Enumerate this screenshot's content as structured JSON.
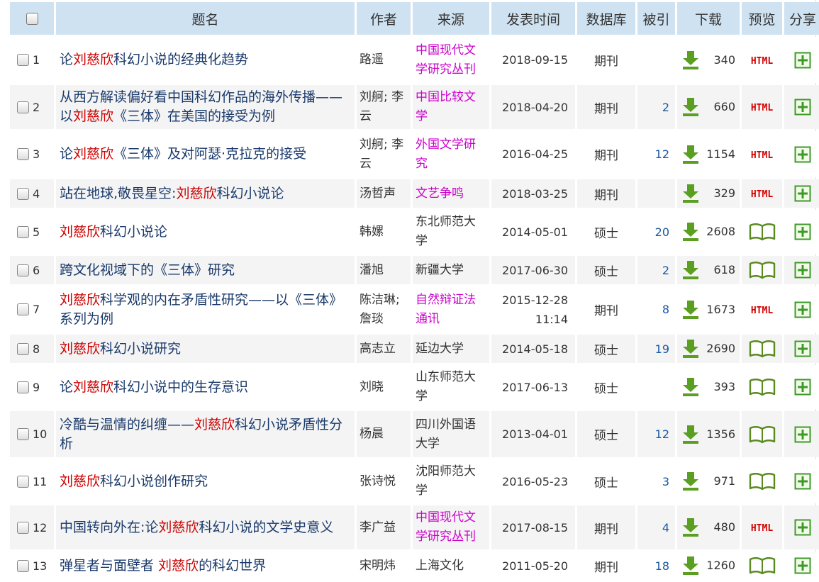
{
  "header": {
    "title": "题名",
    "author": "作者",
    "source": "来源",
    "date": "发表时间",
    "database": "数据库",
    "cited": "被引",
    "download": "下载",
    "preview": "预览",
    "share": "分享"
  },
  "rows": [
    {
      "num": "1",
      "title": [
        {
          "t": "论"
        },
        {
          "t": "刘慈欣",
          "kw": true
        },
        {
          "t": "科幻小说的经典化趋势"
        }
      ],
      "author": "路遥",
      "source": "中国现代文学研究丛刊",
      "source_color": "pink",
      "date": "2018-09-15",
      "db": "期刊",
      "cited": "",
      "downloads": "340",
      "preview": "html"
    },
    {
      "num": "2",
      "title": [
        {
          "t": "从西方解读偏好看中国科幻作品的海外传播——以"
        },
        {
          "t": "刘慈欣",
          "kw": true
        },
        {
          "t": "《三体》在美国的接受为例"
        }
      ],
      "author": "刘舸; 李云",
      "source": "中国比较文学",
      "source_color": "pink",
      "date": "2018-04-20",
      "db": "期刊",
      "cited": "2",
      "downloads": "660",
      "preview": "html"
    },
    {
      "num": "3",
      "title": [
        {
          "t": "论"
        },
        {
          "t": "刘慈欣",
          "kw": true
        },
        {
          "t": "《三体》及对阿瑟·克拉克的接受"
        }
      ],
      "author": "刘舸; 李云",
      "source": "外国文学研究",
      "source_color": "pink",
      "date": "2016-04-25",
      "db": "期刊",
      "cited": "12",
      "downloads": "1154",
      "preview": "html"
    },
    {
      "num": "4",
      "title": [
        {
          "t": "站在地球,敬畏星空:"
        },
        {
          "t": "刘慈欣",
          "kw": true
        },
        {
          "t": "科幻小说论"
        }
      ],
      "author": "汤哲声",
      "source": "文艺争鸣",
      "source_color": "pink",
      "date": "2018-03-25",
      "db": "期刊",
      "cited": "",
      "downloads": "329",
      "preview": "html"
    },
    {
      "num": "5",
      "title": [
        {
          "t": "刘慈欣",
          "kw": true
        },
        {
          "t": "科幻小说论"
        }
      ],
      "author": "韩嫘",
      "source": "东北师范大学",
      "source_color": "dark",
      "date": "2014-05-01",
      "db": "硕士",
      "cited": "20",
      "downloads": "2608",
      "preview": "book"
    },
    {
      "num": "6",
      "title": [
        {
          "t": "跨文化视域下的《三体》研究"
        }
      ],
      "author": "潘旭",
      "source": "新疆大学",
      "source_color": "dark",
      "date": "2017-06-30",
      "db": "硕士",
      "cited": "2",
      "downloads": "618",
      "preview": "book"
    },
    {
      "num": "7",
      "title": [
        {
          "t": "刘慈欣",
          "kw": true
        },
        {
          "t": "科学观的内在矛盾性研究——以《三体》系列为例"
        }
      ],
      "author": "陈洁琳; 詹琰",
      "source": "自然辩证法通讯",
      "source_color": "pink",
      "date": "2015-12-28 11:14",
      "db": "期刊",
      "cited": "8",
      "downloads": "1673",
      "preview": "html"
    },
    {
      "num": "8",
      "title": [
        {
          "t": "刘慈欣",
          "kw": true
        },
        {
          "t": "科幻小说研究"
        }
      ],
      "author": "高志立",
      "source": "延边大学",
      "source_color": "dark",
      "date": "2014-05-18",
      "db": "硕士",
      "cited": "19",
      "downloads": "2690",
      "preview": "book"
    },
    {
      "num": "9",
      "title": [
        {
          "t": "论"
        },
        {
          "t": "刘慈欣",
          "kw": true
        },
        {
          "t": "科幻小说中的生存意识"
        }
      ],
      "author": "刘晓",
      "source": "山东师范大学",
      "source_color": "dark",
      "date": "2017-06-13",
      "db": "硕士",
      "cited": "",
      "downloads": "393",
      "preview": "book"
    },
    {
      "num": "10",
      "title": [
        {
          "t": "冷酷与温情的纠缠——"
        },
        {
          "t": "刘慈欣",
          "kw": true
        },
        {
          "t": "科幻小说矛盾性分析"
        }
      ],
      "author": "杨晨",
      "source": "四川外国语大学",
      "source_color": "dark",
      "date": "2013-04-01",
      "db": "硕士",
      "cited": "12",
      "downloads": "1356",
      "preview": "book"
    },
    {
      "num": "11",
      "title": [
        {
          "t": "刘慈欣",
          "kw": true
        },
        {
          "t": "科幻小说创作研究"
        }
      ],
      "author": "张诗悦",
      "source": "沈阳师范大学",
      "source_color": "dark",
      "date": "2016-05-23",
      "db": "硕士",
      "cited": "3",
      "downloads": "971",
      "preview": "book"
    },
    {
      "num": "12",
      "title": [
        {
          "t": "中国转向外在:论"
        },
        {
          "t": "刘慈欣",
          "kw": true
        },
        {
          "t": "科幻小说的文学史意义"
        }
      ],
      "author": "李广益",
      "source": "中国现代文学研究丛刊",
      "source_color": "pink",
      "date": "2017-08-15",
      "db": "期刊",
      "cited": "4",
      "downloads": "480",
      "preview": "html"
    },
    {
      "num": "13",
      "title": [
        {
          "t": "弹星者与面壁者 "
        },
        {
          "t": "刘慈欣",
          "kw": true
        },
        {
          "t": "的科幻世界"
        }
      ],
      "author": "宋明炜",
      "source": "上海文化",
      "source_color": "dark",
      "date": "2011-05-20",
      "db": "期刊",
      "cited": "18",
      "downloads": "1260",
      "preview": "book"
    }
  ],
  "preview_html_label": "HTML",
  "colors": {
    "keyword": "#cc0000",
    "source_pink": "#cc00cc",
    "header_bg": "#cfe2f1",
    "row_alt": "#f4f4f4",
    "download_green": "#4a8a1c",
    "share_green": "#3a9a2a"
  },
  "icons": {
    "download": "download-arrow-icon",
    "preview_book": "open-book-icon",
    "share": "plus-square-icon"
  }
}
